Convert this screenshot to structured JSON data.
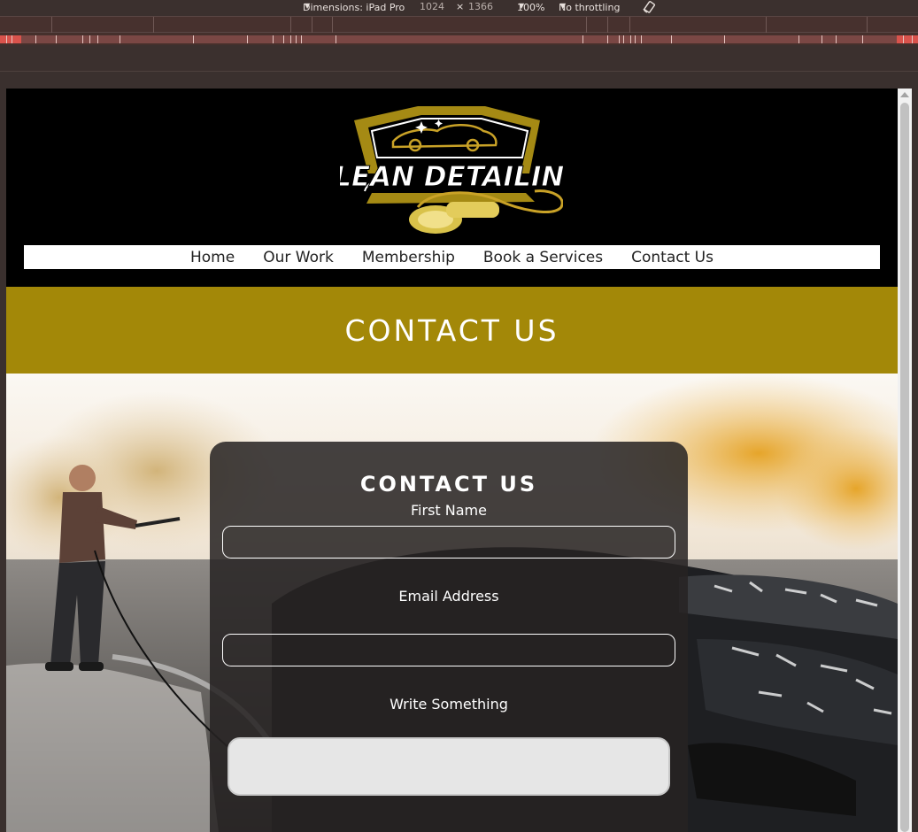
{
  "devtools": {
    "dimensions_label": "Dimensions: iPad Pro",
    "width": "1024",
    "times": "×",
    "height": "1366",
    "zoom": "100%",
    "throttling": "No throttling",
    "rotate_icon": "rotate-icon"
  },
  "site": {
    "logo_text": "KLEAN DETAILING",
    "nav": [
      "Home",
      "Our Work",
      "Membership",
      "Book a Services",
      "Contact Us"
    ],
    "banner_title": "CONTACT US"
  },
  "form": {
    "title": "CONTACT US",
    "first_name_label": "First Name",
    "email_label": "Email Address",
    "message_label": "Write Something",
    "first_name_value": "",
    "email_value": "",
    "message_value": ""
  },
  "colors": {
    "gold": "#a38808",
    "header_bg": "#000000",
    "card_bg": "#262323"
  }
}
